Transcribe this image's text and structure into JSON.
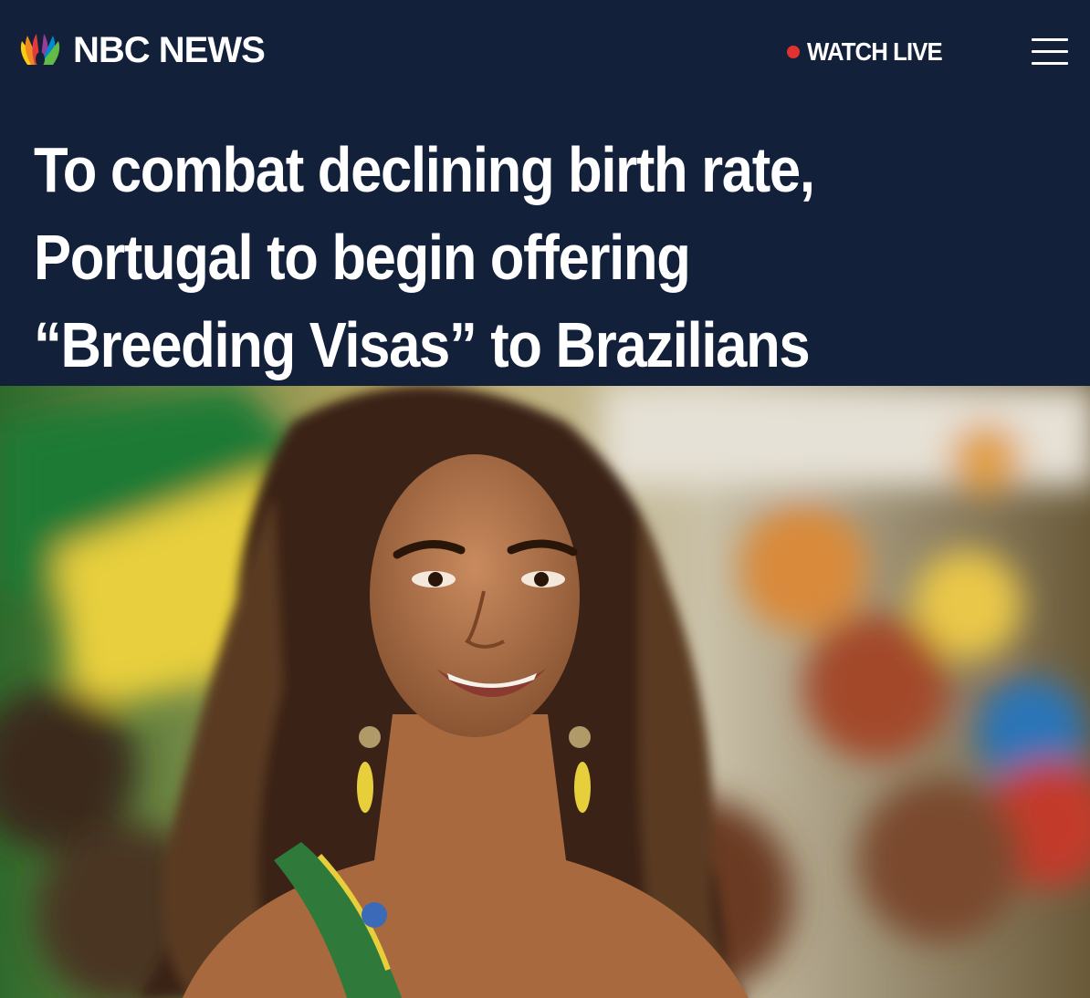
{
  "header": {
    "brand": "NBC NEWS",
    "logo_icon": "peacock-icon",
    "watch_live_label": "WATCH LIVE",
    "live_dot_color": "#e0322e",
    "menu_icon": "hamburger-menu-icon",
    "background_color": "#12203a"
  },
  "article": {
    "headline": "To combat declining birth rate, Portugal to begin offering “Breeding Visas” to Brazilians",
    "hero_image": {
      "dominant_colors": [
        "#2f7a3a",
        "#e2c63a",
        "#5a3a22",
        "#c98a5a"
      ]
    }
  }
}
